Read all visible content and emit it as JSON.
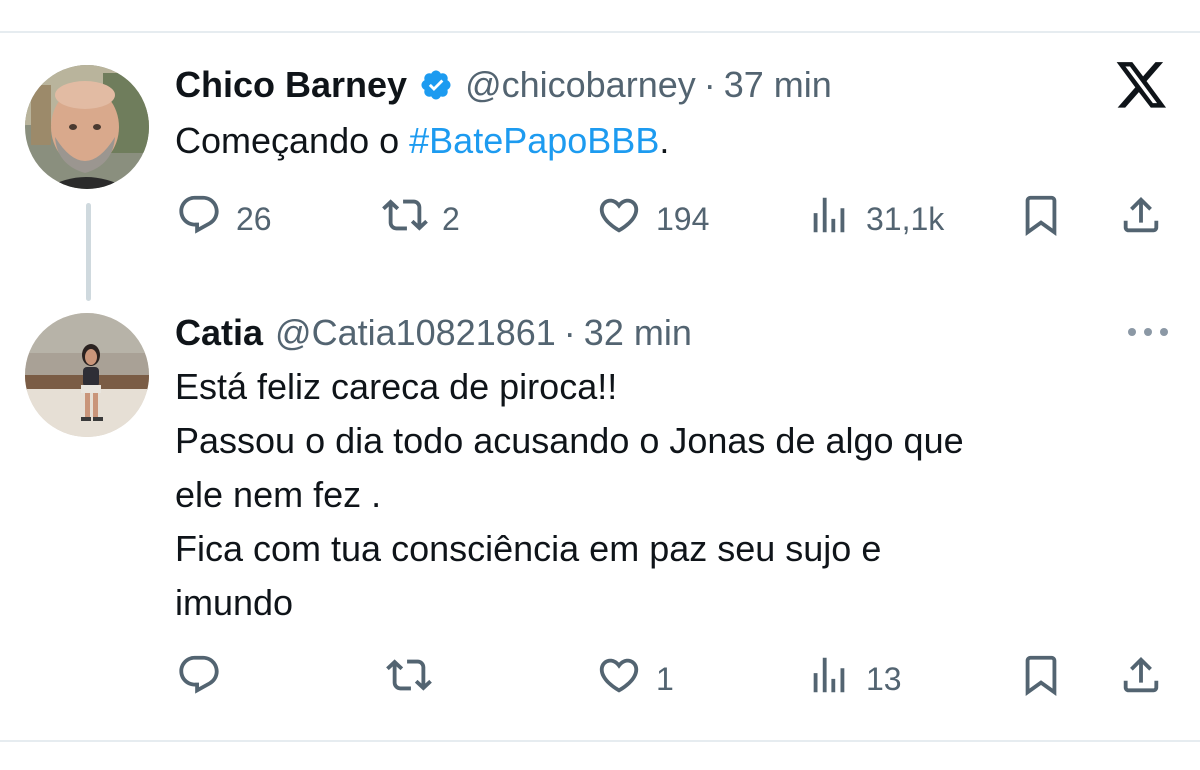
{
  "colors": {
    "hashtag": "#1d9bf0",
    "meta": "#536471",
    "text": "#0f1419",
    "verified": "#1d9bf0"
  },
  "platform_icon": "x-logo-icon",
  "tweets": [
    {
      "name": "Chico Barney",
      "verified": true,
      "handle": "@chicobarney",
      "separator": "·",
      "time": "37 min",
      "text_prefix": "Começando o ",
      "hashtag": "#BatePapoBBB",
      "text_suffix": ".",
      "actions": {
        "replies": "26",
        "retweets": "2",
        "likes": "194",
        "views": "31,1k"
      }
    },
    {
      "name": "Catia",
      "verified": false,
      "handle": "@Catia10821861",
      "separator": "·",
      "time": "32 min",
      "text": "Está feliz careca de piroca!!\nPassou o dia todo acusando o Jonas de algo que\nele nem fez .\nFica com tua consciência em paz seu sujo e\nimundo",
      "actions": {
        "replies": "",
        "retweets": "",
        "likes": "1",
        "views": "13"
      }
    }
  ]
}
